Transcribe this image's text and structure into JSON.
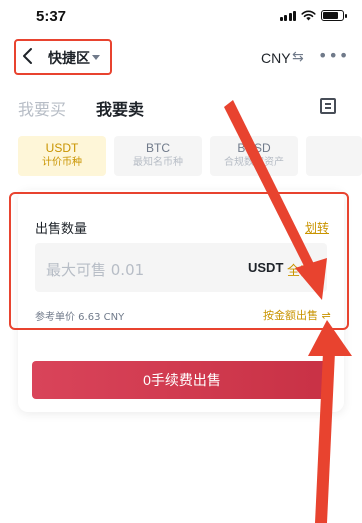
{
  "status_bar": {
    "time": "5:37",
    "icons": [
      "signal-icon",
      "wifi-icon",
      "battery-icon"
    ]
  },
  "nav": {
    "title": "快捷区",
    "currency": "CNY",
    "icons": [
      "back-arrow-icon",
      "caret-down-icon",
      "swap-icon",
      "more-icon"
    ]
  },
  "trade_tabs": {
    "buy_label": "我要买",
    "sell_label": "我要卖",
    "selected": "我要卖"
  },
  "coins": [
    {
      "symbol": "USDT",
      "desc": "计价币种",
      "active": true
    },
    {
      "symbol": "BTC",
      "desc": "最知名币种",
      "active": false
    },
    {
      "symbol": "BUSD",
      "desc": "合规数字资产",
      "active": false
    }
  ],
  "form": {
    "amount_label": "出售数量",
    "transfer_link": "划转",
    "input_placeholder": "最大可售 0.01",
    "input_unit": "USDT",
    "input_all": "全部",
    "reference_price": "参考单价 6.63 CNY",
    "amount_mode": "按金额出售 ⇌"
  },
  "sell_button": {
    "label": "0手续费出售"
  },
  "colors": {
    "accent": "#c99400",
    "sell_button": "#d1394f",
    "annotation_red": "#e8432f"
  }
}
